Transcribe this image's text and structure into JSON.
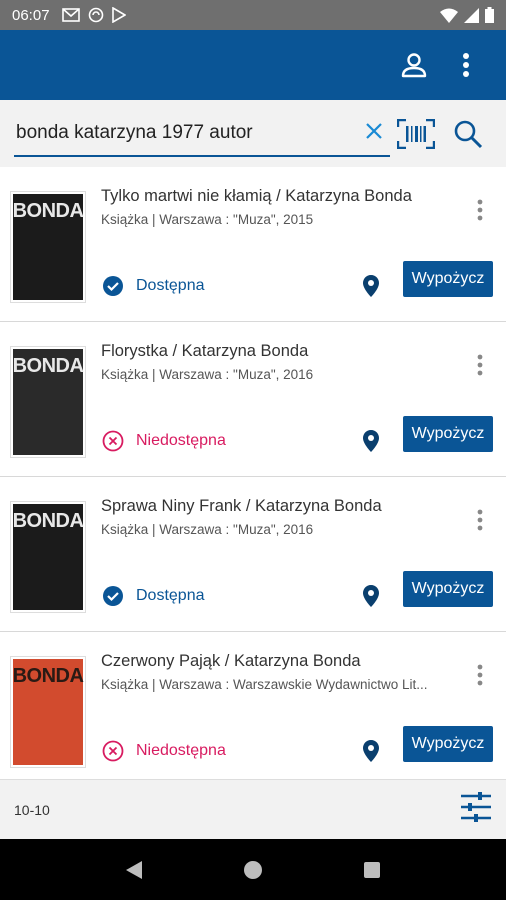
{
  "status_bar": {
    "time": "06:07"
  },
  "search": {
    "value": "bonda katarzyna 1977 autor"
  },
  "results": [
    {
      "title": "Tylko martwi nie kłamią / Katarzyna Bonda",
      "meta": "Książka | Warszawa : \"Muza\", 2015",
      "cover_text": "BONDA",
      "status": "Dostępna",
      "available": true,
      "borrow_label": "Wypożycz"
    },
    {
      "title": "Florystka / Katarzyna Bonda",
      "meta": "Książka | Warszawa : \"Muza\", 2016",
      "cover_text": "BONDA",
      "status": "Niedostępna",
      "available": false,
      "borrow_label": "Wypożycz"
    },
    {
      "title": "Sprawa Niny Frank / Katarzyna Bonda",
      "meta": "Książka | Warszawa : \"Muza\", 2016",
      "cover_text": "BONDA",
      "status": "Dostępna",
      "available": true,
      "borrow_label": "Wypożycz"
    },
    {
      "title": "Czerwony Pająk / Katarzyna Bonda",
      "meta": "Książka | Warszawa : Warszawskie Wydawnictwo Lit...",
      "cover_text": "BONDA",
      "status": "Niedostępna",
      "available": false,
      "borrow_label": "Wypożycz"
    }
  ],
  "footer": {
    "count": "10-10"
  },
  "colors": {
    "primary": "#0a5596",
    "unavailable": "#d81b60"
  },
  "icons": {
    "account": "account-icon",
    "more": "more-vert-icon",
    "clear": "close-icon",
    "barcode": "barcode-scan-icon",
    "search": "search-icon",
    "location": "location-pin-icon",
    "filter": "filter-sliders-icon"
  }
}
